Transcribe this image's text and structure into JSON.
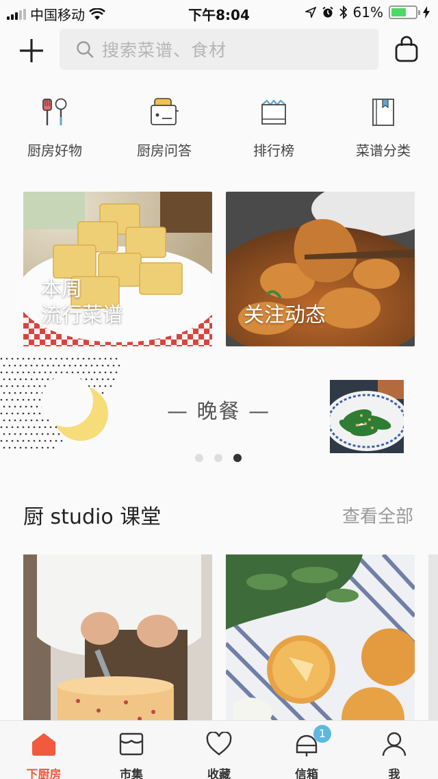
{
  "status_bar": {
    "carrier": "中国移动",
    "time": "下午8:04",
    "battery_percent": "61%",
    "battery_level": 0.61
  },
  "header": {
    "search_placeholder": "搜索菜谱、食材"
  },
  "quick_nav": [
    {
      "label": "厨房好物",
      "icon": "utensils-icon"
    },
    {
      "label": "厨房问答",
      "icon": "toaster-icon"
    },
    {
      "label": "排行榜",
      "icon": "crown-icon"
    },
    {
      "label": "菜谱分类",
      "icon": "book-icon"
    }
  ],
  "feature_cards": [
    {
      "line1": "本周",
      "line2": "流行菜谱"
    },
    {
      "line1": "关注动态"
    }
  ],
  "meal": {
    "title": "— 晚餐 —",
    "pager_total": 3,
    "pager_active": 3
  },
  "studio": {
    "title": "厨 studio 课堂",
    "see_all": "查看全部"
  },
  "tabs": [
    {
      "label": "下厨房",
      "icon": "home-icon",
      "active": true
    },
    {
      "label": "市集",
      "icon": "market-icon"
    },
    {
      "label": "收藏",
      "icon": "heart-icon"
    },
    {
      "label": "信箱",
      "icon": "mailbox-icon",
      "badge": "1"
    },
    {
      "label": "我",
      "icon": "profile-icon"
    }
  ],
  "colors": {
    "accent": "#f15a3c",
    "badge": "#5db8e0",
    "battery": "#4cd964"
  }
}
